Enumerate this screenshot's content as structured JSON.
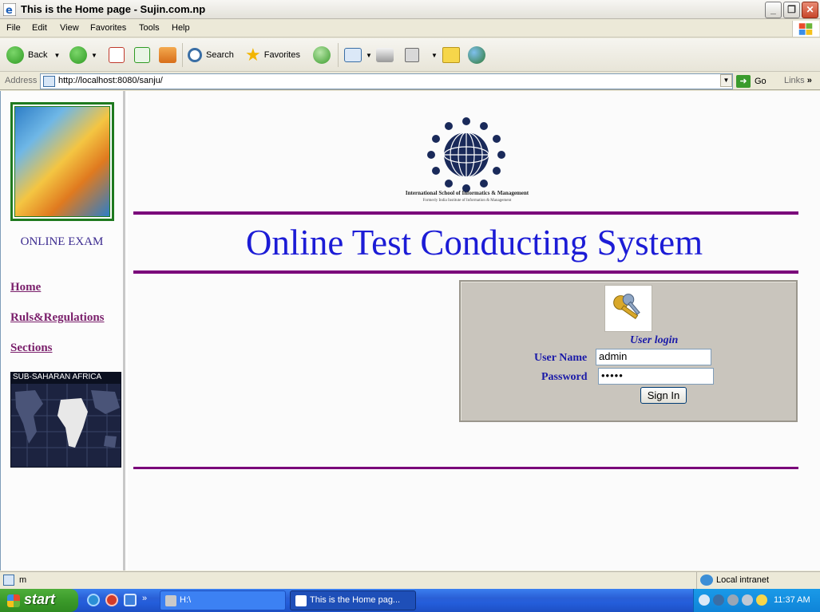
{
  "window": {
    "title": "This is the Home page - Sujin.com.np"
  },
  "menu": [
    "File",
    "Edit",
    "View",
    "Favorites",
    "Tools",
    "Help"
  ],
  "toolbar": {
    "back_label": "Back",
    "search_label": "Search",
    "favorites_label": "Favorites"
  },
  "address": {
    "label": "Address",
    "url": "http://localhost:8080/sanju/",
    "go_label": "Go",
    "links_label": "Links"
  },
  "sidebar": {
    "section_title": "ONLINE EXAM",
    "nav": [
      {
        "label": "Home"
      },
      {
        "label": "Ruls&Regulations"
      },
      {
        "label": "Sections"
      }
    ],
    "map_title": "SUB-SAHARAN AFRICA"
  },
  "main": {
    "school_name": "International School of Informatics & Management",
    "school_affiliation": "Formerly India Institute of Information & Management",
    "heading": "Online Test Conducting System"
  },
  "login": {
    "title": "User login",
    "username_label": "User Name",
    "username_value": "admin",
    "password_label": "Password",
    "password_value": "•••••",
    "signin_label": "Sign In"
  },
  "statusbar": {
    "text": "m",
    "zone": "Local intranet"
  },
  "taskbar": {
    "start_label": "start",
    "tasks": [
      {
        "label": "H:\\"
      },
      {
        "label": "This is the Home pag..."
      }
    ],
    "clock": "11:37 AM"
  },
  "colors": {
    "divider": "#7a007a",
    "heading": "#1c1cd6",
    "nav_link": "#7a1f6b",
    "login_text": "#1a1aa8"
  }
}
